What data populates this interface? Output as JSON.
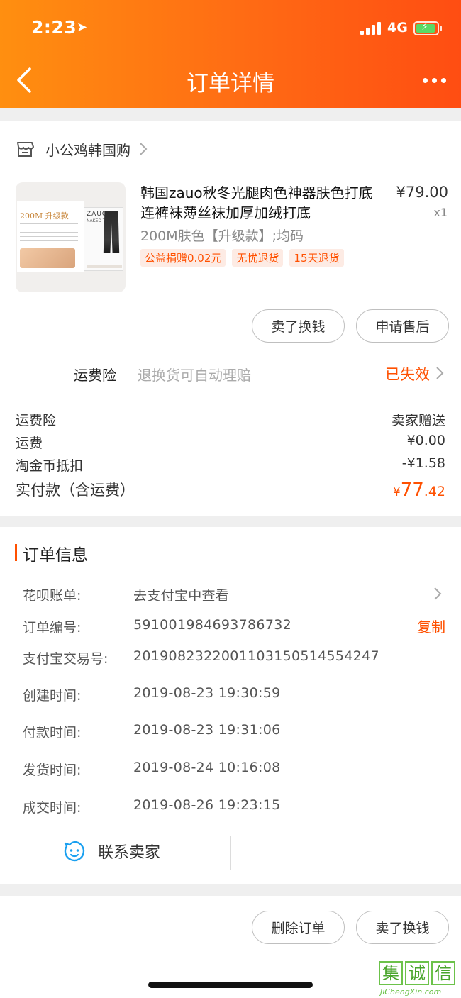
{
  "status_bar": {
    "time": "2:23",
    "location_glyph": "➤",
    "network": "4G"
  },
  "nav": {
    "title": "订单详情"
  },
  "shop": {
    "name": "小公鸡韩国购"
  },
  "product": {
    "title": "韩国zauo秋冬光腿肉色神器肤色打底连裤袜薄丝袜加厚加绒打底",
    "price": "¥79.00",
    "quantity": "x1",
    "sku": "200M肤色【升级款】;均码",
    "tags": [
      "公益捐赠0.02元",
      "无忧退货",
      "15天退货"
    ],
    "thumb": {
      "tag": "200M 升级款",
      "brand": "ZAUO",
      "sub": "NAKED TIGHTS"
    }
  },
  "item_actions": {
    "sell": "卖了换钱",
    "after_sale": "申请售后"
  },
  "insurance": {
    "label": "运费险",
    "desc": "退换货可自动理赔",
    "status": "已失效"
  },
  "fees": [
    {
      "label": "运费险",
      "value": "卖家赠送"
    },
    {
      "label": "运费",
      "value": "¥0.00"
    },
    {
      "label": "淘金币抵扣",
      "value": "-¥1.58"
    }
  ],
  "total": {
    "label": "实付款（含运费）",
    "currency": "¥",
    "integer": "77",
    "decimal": ".42"
  },
  "order_info": {
    "title": "订单信息",
    "rows": [
      {
        "key": "花呗账单:",
        "value": "去支付宝中查看"
      },
      {
        "key": "订单编号:",
        "value": "591001984693786732"
      },
      {
        "key": "支付宝交易号:",
        "value": "2019082322001103150514554247"
      },
      {
        "key": "创建时间:",
        "value": "2019-08-23 19:30:59"
      },
      {
        "key": "付款时间:",
        "value": "2019-08-23 19:31:06"
      },
      {
        "key": "发货时间:",
        "value": "2019-08-24 10:16:08"
      },
      {
        "key": "成交时间:",
        "value": "2019-08-26 19:23:15"
      }
    ],
    "copy_label": "复制"
  },
  "contact": {
    "label": "联系卖家"
  },
  "bottom_actions": {
    "delete": "删除订单",
    "sell": "卖了换钱"
  },
  "watermark": {
    "chars": [
      "集",
      "诚",
      "信"
    ],
    "domain": "JiChengXin.com"
  },
  "colors": {
    "accent": "#ff5000",
    "header_start": "#ff8f10",
    "header_end": "#ff4d12"
  }
}
